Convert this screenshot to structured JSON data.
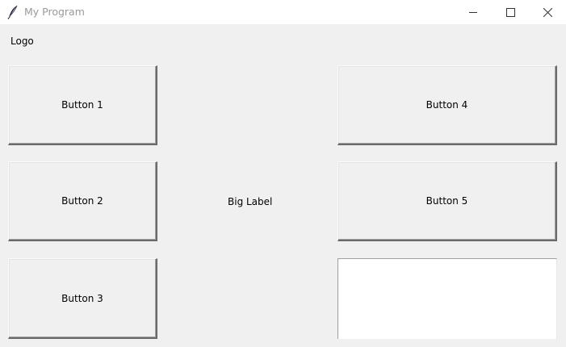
{
  "window": {
    "title": "My Program",
    "icon": "feather-icon",
    "controls": [
      "minimize-icon",
      "maximize-icon",
      "close-icon"
    ]
  },
  "logo": {
    "label": "Logo"
  },
  "buttons": [
    {
      "label": "Button 1"
    },
    {
      "label": "Button 2"
    },
    {
      "label": "Button 3"
    },
    {
      "label": "Button 4"
    },
    {
      "label": "Button 5"
    }
  ],
  "big_label": {
    "text": "Big Label"
  },
  "text_area": {
    "value": ""
  },
  "colors": {
    "window_bg": "#f0f0f0",
    "titlebar_bg": "#ffffff",
    "title_text": "#9a9a9a"
  }
}
